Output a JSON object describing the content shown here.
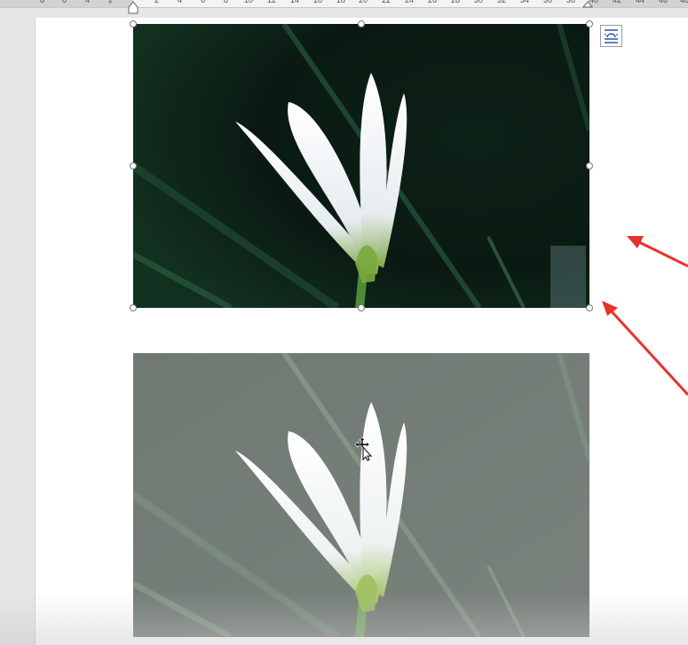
{
  "ruler": {
    "left_ticks": [
      "8",
      "6",
      "4",
      "2"
    ],
    "right_ticks": [
      "2",
      "4",
      "6",
      "8",
      "10",
      "12",
      "14",
      "16",
      "18",
      "20",
      "22",
      "24",
      "26",
      "28",
      "30",
      "32",
      "34",
      "36",
      "38",
      "40",
      "42",
      "44",
      "46",
      "48"
    ]
  },
  "document": {
    "images": [
      {
        "name": "white lily photo on dark green background",
        "selected": true
      },
      {
        "name": "white lily photo on grey-green background",
        "selected": false
      }
    ],
    "layout_options_icon": "layout-options-icon",
    "cursor_icon": "move-cursor-icon"
  },
  "annotation": {
    "arrow_color": "#e8322c"
  }
}
